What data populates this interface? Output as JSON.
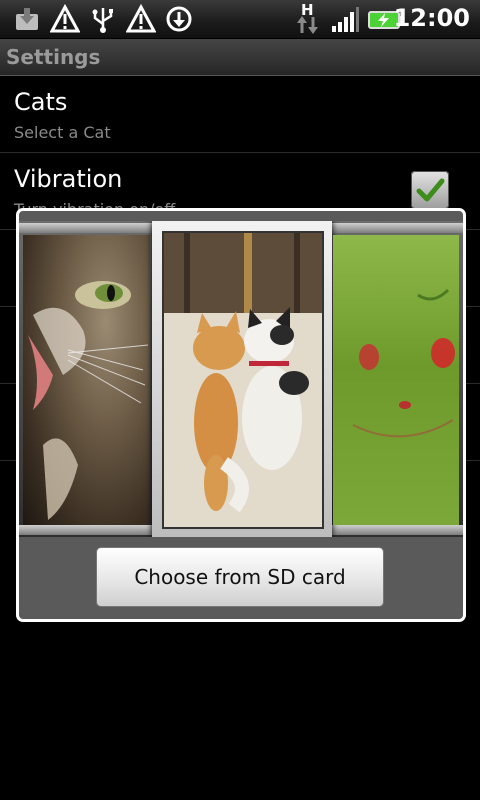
{
  "status_bar": {
    "time": "12:00",
    "network_type": "H",
    "icons": [
      "download-notification-icon",
      "warning-icon",
      "usb-icon",
      "warning-icon",
      "sync-download-icon",
      "data-arrows-icon",
      "signal-bars-icon",
      "battery-charging-icon"
    ],
    "battery_color": "#4cd137"
  },
  "title_bar": {
    "title": "Settings"
  },
  "preferences": [
    {
      "title": "Cats",
      "summary": "Select a Cat"
    },
    {
      "title": "Vibration",
      "summary": "Turn vibration on/off",
      "checked": true
    }
  ],
  "dialog": {
    "gallery_images": [
      "cat-closeup-image",
      "two-cats-cuddling-image",
      "green-cat-image"
    ],
    "selected_index": 1,
    "button_label": "Choose from SD card"
  },
  "colors": {
    "accent_check": "#3d8c1c",
    "dialog_border": "#ffffff"
  }
}
